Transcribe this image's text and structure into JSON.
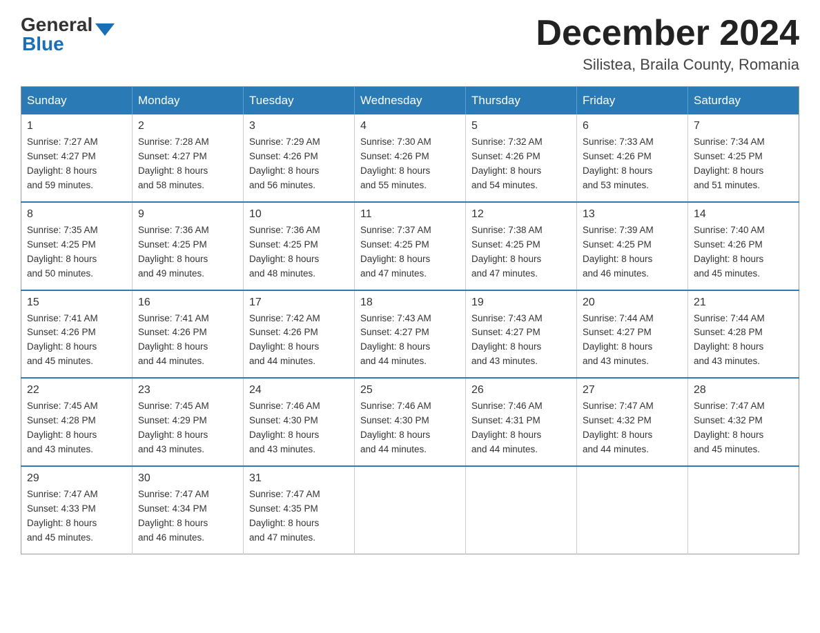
{
  "header": {
    "logo_general": "General",
    "logo_blue": "Blue",
    "month_title": "December 2024",
    "location": "Silistea, Braila County, Romania"
  },
  "days_of_week": [
    "Sunday",
    "Monday",
    "Tuesday",
    "Wednesday",
    "Thursday",
    "Friday",
    "Saturday"
  ],
  "weeks": [
    [
      {
        "day": "1",
        "sunrise": "7:27 AM",
        "sunset": "4:27 PM",
        "daylight": "8 hours and 59 minutes."
      },
      {
        "day": "2",
        "sunrise": "7:28 AM",
        "sunset": "4:27 PM",
        "daylight": "8 hours and 58 minutes."
      },
      {
        "day": "3",
        "sunrise": "7:29 AM",
        "sunset": "4:26 PM",
        "daylight": "8 hours and 56 minutes."
      },
      {
        "day": "4",
        "sunrise": "7:30 AM",
        "sunset": "4:26 PM",
        "daylight": "8 hours and 55 minutes."
      },
      {
        "day": "5",
        "sunrise": "7:32 AM",
        "sunset": "4:26 PM",
        "daylight": "8 hours and 54 minutes."
      },
      {
        "day": "6",
        "sunrise": "7:33 AM",
        "sunset": "4:26 PM",
        "daylight": "8 hours and 53 minutes."
      },
      {
        "day": "7",
        "sunrise": "7:34 AM",
        "sunset": "4:25 PM",
        "daylight": "8 hours and 51 minutes."
      }
    ],
    [
      {
        "day": "8",
        "sunrise": "7:35 AM",
        "sunset": "4:25 PM",
        "daylight": "8 hours and 50 minutes."
      },
      {
        "day": "9",
        "sunrise": "7:36 AM",
        "sunset": "4:25 PM",
        "daylight": "8 hours and 49 minutes."
      },
      {
        "day": "10",
        "sunrise": "7:36 AM",
        "sunset": "4:25 PM",
        "daylight": "8 hours and 48 minutes."
      },
      {
        "day": "11",
        "sunrise": "7:37 AM",
        "sunset": "4:25 PM",
        "daylight": "8 hours and 47 minutes."
      },
      {
        "day": "12",
        "sunrise": "7:38 AM",
        "sunset": "4:25 PM",
        "daylight": "8 hours and 47 minutes."
      },
      {
        "day": "13",
        "sunrise": "7:39 AM",
        "sunset": "4:25 PM",
        "daylight": "8 hours and 46 minutes."
      },
      {
        "day": "14",
        "sunrise": "7:40 AM",
        "sunset": "4:26 PM",
        "daylight": "8 hours and 45 minutes."
      }
    ],
    [
      {
        "day": "15",
        "sunrise": "7:41 AM",
        "sunset": "4:26 PM",
        "daylight": "8 hours and 45 minutes."
      },
      {
        "day": "16",
        "sunrise": "7:41 AM",
        "sunset": "4:26 PM",
        "daylight": "8 hours and 44 minutes."
      },
      {
        "day": "17",
        "sunrise": "7:42 AM",
        "sunset": "4:26 PM",
        "daylight": "8 hours and 44 minutes."
      },
      {
        "day": "18",
        "sunrise": "7:43 AM",
        "sunset": "4:27 PM",
        "daylight": "8 hours and 44 minutes."
      },
      {
        "day": "19",
        "sunrise": "7:43 AM",
        "sunset": "4:27 PM",
        "daylight": "8 hours and 43 minutes."
      },
      {
        "day": "20",
        "sunrise": "7:44 AM",
        "sunset": "4:27 PM",
        "daylight": "8 hours and 43 minutes."
      },
      {
        "day": "21",
        "sunrise": "7:44 AM",
        "sunset": "4:28 PM",
        "daylight": "8 hours and 43 minutes."
      }
    ],
    [
      {
        "day": "22",
        "sunrise": "7:45 AM",
        "sunset": "4:28 PM",
        "daylight": "8 hours and 43 minutes."
      },
      {
        "day": "23",
        "sunrise": "7:45 AM",
        "sunset": "4:29 PM",
        "daylight": "8 hours and 43 minutes."
      },
      {
        "day": "24",
        "sunrise": "7:46 AM",
        "sunset": "4:30 PM",
        "daylight": "8 hours and 43 minutes."
      },
      {
        "day": "25",
        "sunrise": "7:46 AM",
        "sunset": "4:30 PM",
        "daylight": "8 hours and 44 minutes."
      },
      {
        "day": "26",
        "sunrise": "7:46 AM",
        "sunset": "4:31 PM",
        "daylight": "8 hours and 44 minutes."
      },
      {
        "day": "27",
        "sunrise": "7:47 AM",
        "sunset": "4:32 PM",
        "daylight": "8 hours and 44 minutes."
      },
      {
        "day": "28",
        "sunrise": "7:47 AM",
        "sunset": "4:32 PM",
        "daylight": "8 hours and 45 minutes."
      }
    ],
    [
      {
        "day": "29",
        "sunrise": "7:47 AM",
        "sunset": "4:33 PM",
        "daylight": "8 hours and 45 minutes."
      },
      {
        "day": "30",
        "sunrise": "7:47 AM",
        "sunset": "4:34 PM",
        "daylight": "8 hours and 46 minutes."
      },
      {
        "day": "31",
        "sunrise": "7:47 AM",
        "sunset": "4:35 PM",
        "daylight": "8 hours and 47 minutes."
      },
      null,
      null,
      null,
      null
    ]
  ],
  "labels": {
    "sunrise_prefix": "Sunrise: ",
    "sunset_prefix": "Sunset: ",
    "daylight_prefix": "Daylight: "
  }
}
